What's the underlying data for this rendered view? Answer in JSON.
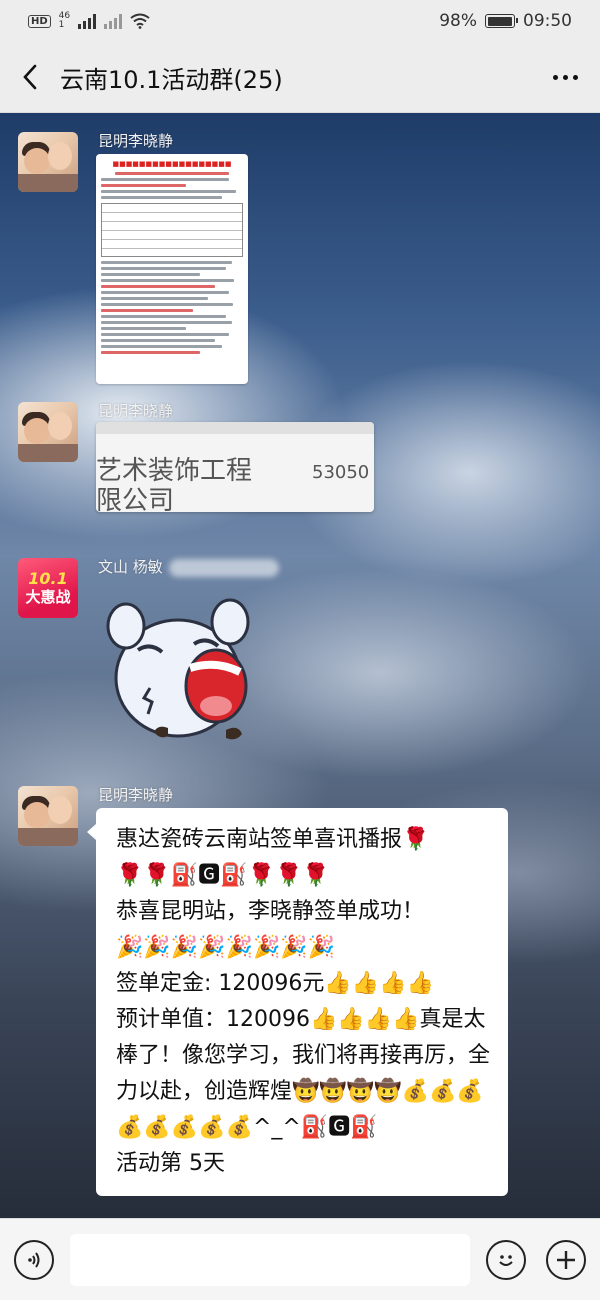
{
  "status_bar": {
    "hd": "HD",
    "net_top": "46",
    "net_bottom": "1",
    "battery": "98%",
    "battery_level": 0.98,
    "time": "09:50"
  },
  "nav": {
    "title": "云南10.1活动群(25)"
  },
  "messages": [
    {
      "sender": "昆明李晓静",
      "type": "image",
      "image": "document-photo"
    },
    {
      "sender": "昆明李晓静",
      "type": "image",
      "image": "cropped-document-photo",
      "image_text": {
        "line1": "艺术装饰工程",
        "line2": "限公司",
        "number": "53050"
      }
    },
    {
      "sender": "文山 杨敏",
      "type": "sticker",
      "image": "laughing-cartoon-sticker"
    },
    {
      "sender": "昆明李晓静",
      "type": "text",
      "lines": [
        "惠达瓷砖云南站签单喜讯播报🌹",
        "🌹🌹⛽🅶⛽🌹🌹🌹",
        "恭喜昆明站，李晓静签单成功！",
        "🎉🎉🎉🎉🎉🎉🎉🎉",
        "签单定金: 120096元👍👍👍👍",
        "预计单值：120096👍👍👍👍真是太棒了！像您学习，我们将再接再厉，全力以赴，创造辉煌🤠🤠🤠🤠💰💰💰💰💰💰💰💰^_^⛽🅶⛽",
        "活动第 5天"
      ]
    }
  ],
  "promo_avatar": {
    "top": "10.1",
    "bottom": "大惠战"
  },
  "colors": {
    "bar_bg": "#ededed",
    "bubble_bg": "#ffffff",
    "promo_red": "#e0154a"
  }
}
